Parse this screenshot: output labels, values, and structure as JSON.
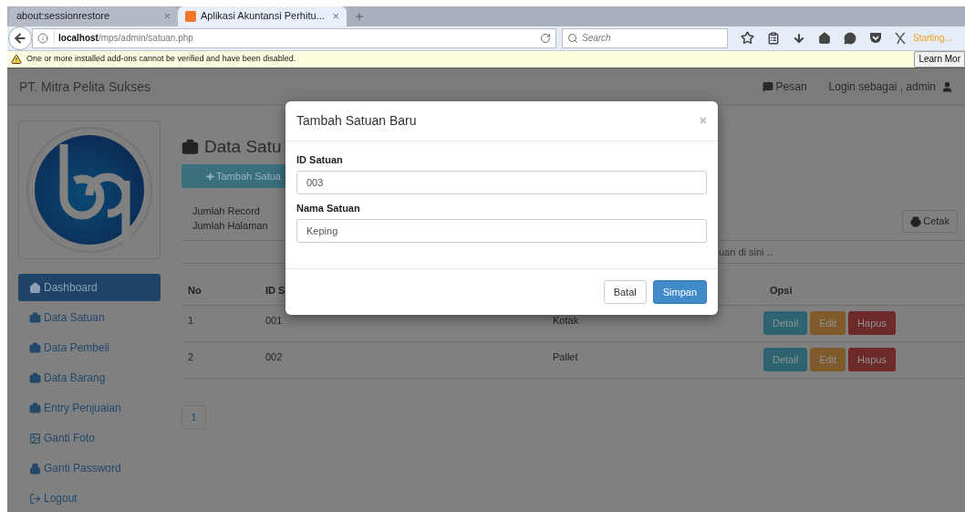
{
  "browser": {
    "tabs": [
      {
        "title": "about:sessionrestore",
        "close": "×",
        "selected": false
      },
      {
        "title": "Aplikasi Akuntansi Perhitu...",
        "close": "×",
        "selected": true
      }
    ],
    "url_host": "localhost",
    "url_path": "/mps/admin/satuan.php",
    "search_placeholder": "Search",
    "status": "Starting...",
    "notification": {
      "text": "One or more installed add-ons cannot be verified and have been disabled.",
      "button": "Learn Mor"
    }
  },
  "navbar": {
    "brand": "PT. Mitra Pelita Sukses",
    "messages": "Pesan",
    "login": "Login sebagai , admin"
  },
  "sidebar": {
    "items": [
      {
        "label": "Dashboard",
        "kind": "home",
        "selected": true
      },
      {
        "label": "Data Satuan",
        "kind": "data",
        "selected": false
      },
      {
        "label": "Data Pembeli",
        "kind": "data",
        "selected": false
      },
      {
        "label": "Data Barang",
        "kind": "data",
        "selected": false
      },
      {
        "label": "Entry Penjualan",
        "kind": "data",
        "selected": false
      },
      {
        "label": "Ganti Foto",
        "kind": "photo",
        "selected": false
      },
      {
        "label": "Ganti Password",
        "kind": "password",
        "selected": false
      },
      {
        "label": "Logout",
        "kind": "logout",
        "selected": false
      }
    ]
  },
  "main": {
    "title": "Data Satu",
    "add_button": "Tambah Satua",
    "info": [
      "Jumlah Record",
      "Jumlah Halaman"
    ],
    "print_button": "Cetak",
    "search_placeholder": "uan di sini ..",
    "table": {
      "columns": [
        {
          "header": "No"
        },
        {
          "header": "ID S"
        },
        {},
        {
          "header": "Opsi"
        }
      ],
      "rows": [
        {
          "cells": [
            "1",
            "001",
            "Kotak"
          ],
          "actions": [
            {
              "label": "Detail",
              "kind": "info"
            },
            {
              "label": "Edit",
              "kind": "warning"
            },
            {
              "label": "Hapus",
              "kind": "danger"
            }
          ]
        },
        {
          "cells": [
            "2",
            "002",
            "Pallet"
          ],
          "actions": [
            {
              "label": "Detail",
              "kind": "info"
            },
            {
              "label": "Edit",
              "kind": "warning"
            },
            {
              "label": "Hapus",
              "kind": "danger"
            }
          ]
        }
      ]
    },
    "pagination": [
      {
        "label": "1",
        "selected": false
      }
    ]
  },
  "modal": {
    "title": "Tambah Satuan Baru",
    "close": "×",
    "fields": [
      {
        "label": "ID Satuan",
        "value": "003"
      },
      {
        "label": "Nama Satuan",
        "value": "Keping"
      }
    ],
    "buttons": [
      {
        "label": "Batal",
        "kind": "default"
      },
      {
        "label": "Simpan",
        "kind": "primary"
      }
    ]
  }
}
